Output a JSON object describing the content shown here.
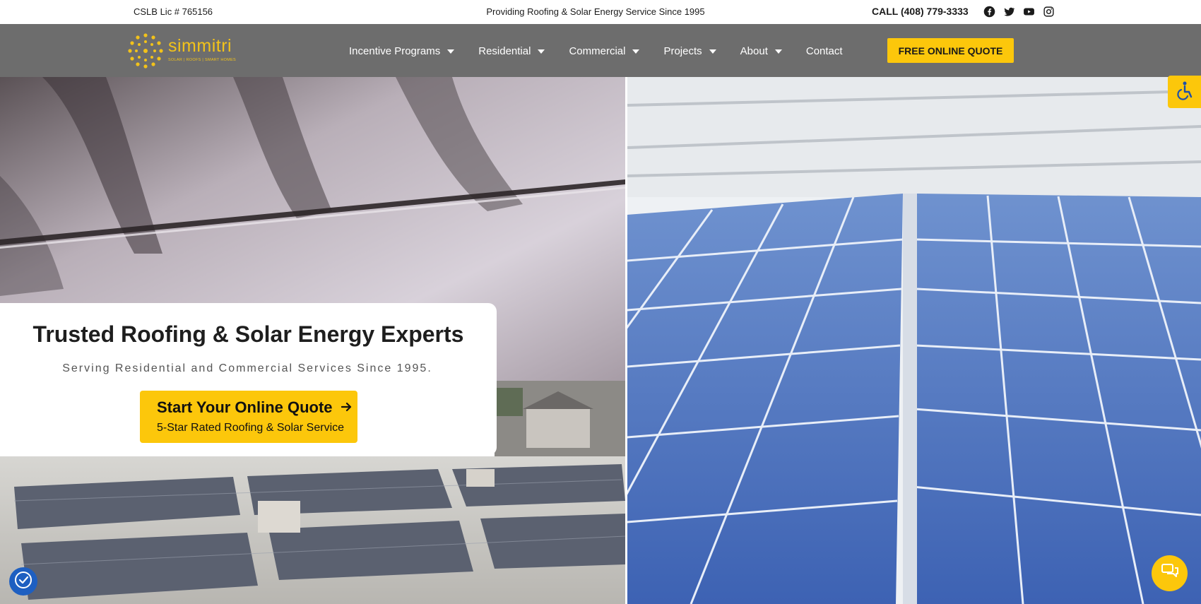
{
  "topbar": {
    "license": "CSLB Lic # 765156",
    "tagline": "Providing Roofing & Solar Energy Service Since 1995",
    "phone": "CALL (408) 779-3333",
    "social_icons": [
      "facebook-icon",
      "twitter-icon",
      "youtube-icon",
      "instagram-icon"
    ]
  },
  "nav": {
    "logo_text": "simmitri",
    "logo_sub": "SOLAR | ROOFS | SMART HOMES",
    "items": [
      {
        "label": "Incentive Programs",
        "has_dropdown": true
      },
      {
        "label": "Residential",
        "has_dropdown": true
      },
      {
        "label": "Commercial",
        "has_dropdown": true
      },
      {
        "label": "Projects",
        "has_dropdown": true
      },
      {
        "label": "About",
        "has_dropdown": true
      },
      {
        "label": "Contact",
        "has_dropdown": false
      }
    ],
    "quote_button": "FREE ONLINE QUOTE"
  },
  "hero": {
    "title": "Trusted Roofing & Solar Energy Experts",
    "subtitle": "Serving Residential and Commercial Services Since 1995.",
    "cta_main": "Start Your Online Quote",
    "cta_sub": "5-Star Rated Roofing & Solar Service"
  },
  "floating": {
    "accessibility": "accessibility-icon",
    "cookie": "cookie-settings-icon",
    "chat": "chat-icon"
  },
  "colors": {
    "accent": "#fcc70b",
    "nav_bg": "#6d6d6d",
    "cookie_blue": "#1e5fc1"
  }
}
